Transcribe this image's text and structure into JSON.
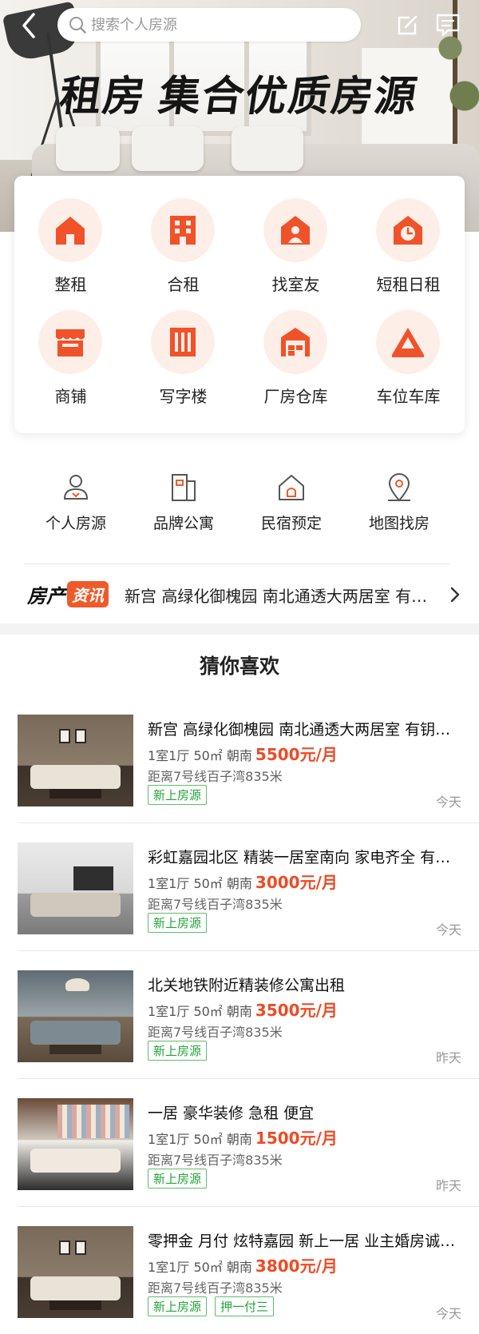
{
  "search": {
    "placeholder": "搜索个人房源"
  },
  "hero": {
    "headline": "租房 集合优质房源"
  },
  "categories": [
    {
      "label": "整租",
      "icon": "house-icon"
    },
    {
      "label": "合租",
      "icon": "building-icon"
    },
    {
      "label": "找室友",
      "icon": "roommate-icon"
    },
    {
      "label": "短租日租",
      "icon": "clock-house-icon"
    },
    {
      "label": "商铺",
      "icon": "shop-icon"
    },
    {
      "label": "写字楼",
      "icon": "office-icon"
    },
    {
      "label": "厂房仓库",
      "icon": "warehouse-icon"
    },
    {
      "label": "车位车库",
      "icon": "parking-cone-icon"
    }
  ],
  "quick_links": [
    {
      "label": "个人房源",
      "icon": "person-icon"
    },
    {
      "label": "品牌公寓",
      "icon": "apartment-icon"
    },
    {
      "label": "民宿预定",
      "icon": "homestay-icon"
    },
    {
      "label": "地图找房",
      "icon": "map-pin-icon"
    }
  ],
  "news": {
    "logo_a": "房产",
    "logo_b": "资讯",
    "text": "新宫 高绿化御槐园 南北通透大两居室 有钥匙"
  },
  "section_title": "猜你喜欢",
  "listings": [
    {
      "title": "新宫 高绿化御槐园 南北通透大两居室 有钥匙随时看",
      "meta": "1室1厅 50㎡ 朝南",
      "price": "5500元/月",
      "dist": "距离7号线百子湾835米",
      "tags": [
        "新上房源"
      ],
      "date": "今天"
    },
    {
      "title": "彩虹嘉园北区 精装一居室南向 家电齐全 有钥匙",
      "meta": "1室1厅 50㎡ 朝南",
      "price": "3000元/月",
      "dist": "距离7号线百子湾835米",
      "tags": [
        "新上房源"
      ],
      "date": "今天"
    },
    {
      "title": "北关地铁附近精装修公寓出租",
      "meta": "1室1厅 50㎡ 朝南",
      "price": "3500元/月",
      "dist": "距离7号线百子湾835米",
      "tags": [
        "新上房源"
      ],
      "date": "昨天"
    },
    {
      "title": "一居 豪华装修 急租 便宜",
      "meta": "1室1厅 50㎡ 朝南",
      "price": "1500元/月",
      "dist": "距离7号线百子湾835米",
      "tags": [
        "新上房源"
      ],
      "date": "昨天"
    },
    {
      "title": "零押金 月付 炫特嘉园 新上一居 业主婚房诚心出租",
      "meta": "1室1厅 50㎡ 朝南",
      "price": "3800元/月",
      "dist": "距离7号线百子湾835米",
      "tags": [
        "新上房源",
        "押一付三"
      ],
      "date": "今天"
    }
  ],
  "colors": {
    "accent": "#ef5a2a",
    "price": "#ef4a25",
    "tag": "#22a33a"
  }
}
